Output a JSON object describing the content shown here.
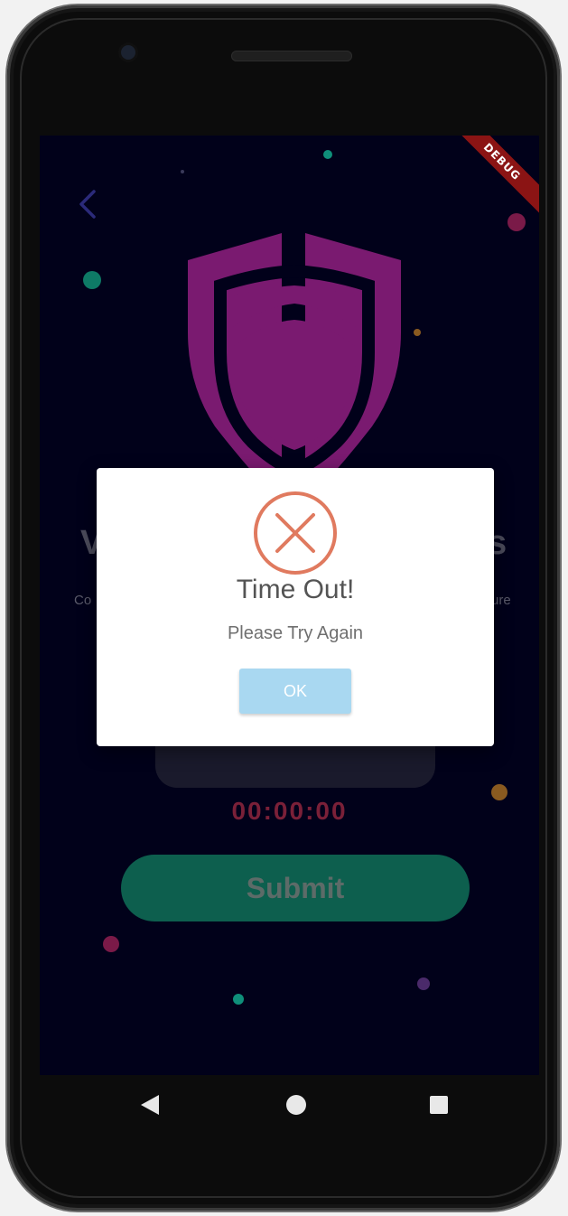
{
  "app": {
    "debug_banner": "DEBUG"
  },
  "background": {
    "title_left_fragment": "V",
    "title_right_fragment": "s",
    "subtitle_left_fragment": "Co",
    "subtitle_right_fragment": "ure",
    "timer_text": "00:00:00",
    "submit_label": "Submit"
  },
  "dialog": {
    "icon": "close-circle-icon",
    "title": "Time Out!",
    "message": "Please Try Again",
    "ok_label": "OK"
  },
  "navigation": {
    "back_icon": "triangle-back-icon",
    "home_icon": "circle-home-icon",
    "recents_icon": "square-recents-icon"
  },
  "colors": {
    "screen_background": "#01011a",
    "shield": "#7a1a70",
    "submit_button": "#0d5f4e",
    "timer": "#7a2038",
    "dialog_icon": "#e07a5f",
    "ok_button": "#a9d8f1",
    "debug_ribbon": "#8b1414"
  }
}
